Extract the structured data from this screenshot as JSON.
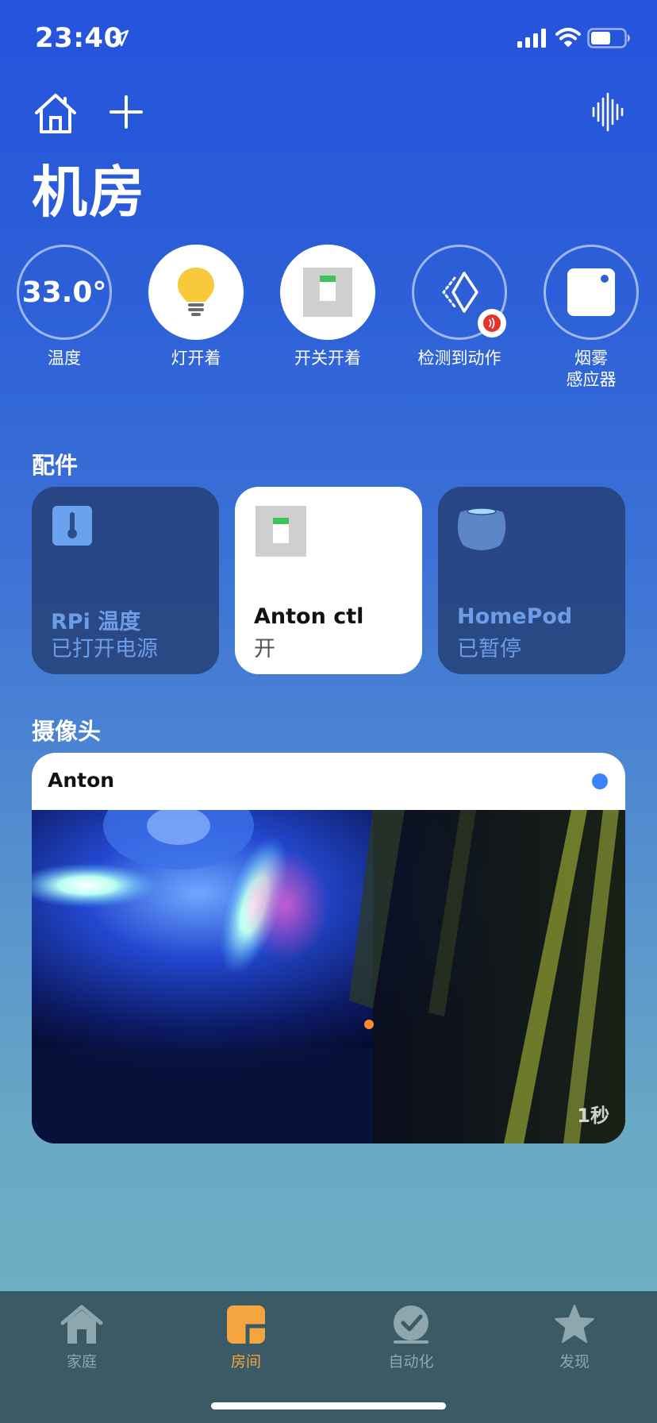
{
  "status_bar": {
    "time": "23:40",
    "location_icon": "location-arrow-icon",
    "signal_icon": "cellular-signal-icon",
    "wifi_icon": "wifi-icon",
    "battery_icon": "battery-icon",
    "battery_level": 0.6
  },
  "header": {
    "home_icon": "home-icon",
    "add_icon": "plus-icon",
    "voice_icon": "voice-waveform-icon",
    "title": "机房"
  },
  "status_items": [
    {
      "value": "33.0°",
      "label": "温度",
      "icon": "temperature-readout"
    },
    {
      "label": "灯开着",
      "icon": "lightbulb-icon"
    },
    {
      "label": "开关开着",
      "icon": "switch-icon"
    },
    {
      "label": "检测到动作",
      "icon": "motion-sensor-icon",
      "badge_icon": "alert-waves-icon"
    },
    {
      "label_line1": "烟雾",
      "label_line2": "感应器",
      "icon": "smoke-sensor-icon"
    }
  ],
  "accessories": {
    "title": "配件",
    "items": [
      {
        "name": "RPi 温度",
        "status": "已打开电源",
        "icon": "thermometer-icon",
        "state": "off"
      },
      {
        "name": "Anton ctl",
        "status": "开",
        "icon": "switch-icon",
        "state": "on"
      },
      {
        "name": "HomePod",
        "status": "已暂停",
        "icon": "homepod-icon",
        "state": "off"
      }
    ]
  },
  "cameras": {
    "title": "摄像头",
    "items": [
      {
        "name": "Anton",
        "age": "1秒",
        "status_color": "#3a82f7"
      }
    ]
  },
  "tab_bar": {
    "tabs": [
      {
        "label": "家庭",
        "icon": "home-tab-icon",
        "active": false
      },
      {
        "label": "房间",
        "icon": "rooms-tab-icon",
        "active": true
      },
      {
        "label": "自动化",
        "icon": "automation-tab-icon",
        "active": false
      },
      {
        "label": "发现",
        "icon": "discover-star-icon",
        "active": false
      }
    ],
    "active_color": "#f5a540",
    "inactive_color": "#8ea6ae"
  }
}
